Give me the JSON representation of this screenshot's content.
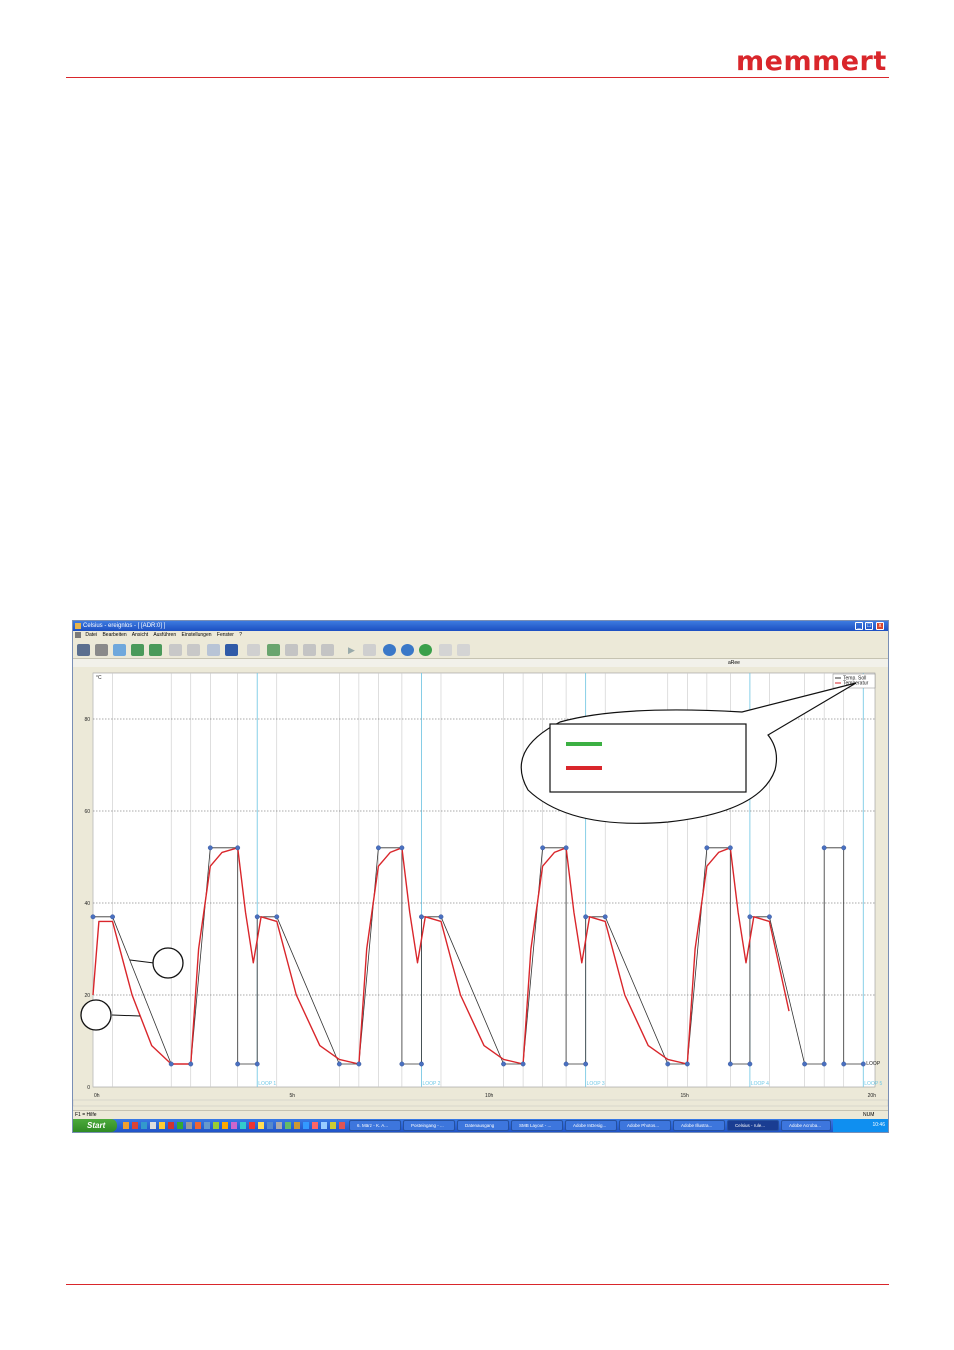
{
  "brand": {
    "logo_text": "memmert",
    "rule_color": "#d9262b"
  },
  "window": {
    "title": "Celsius - ereignlos - [ [ADR:0] ]",
    "menu": [
      "Datei",
      "Bearbeiten",
      "Ansicht",
      "Ausführen",
      "Einstellungen",
      "Fenster",
      "?"
    ],
    "plot_header": "aRee"
  },
  "toolbar": {
    "icons": [
      "open-icon",
      "print-icon",
      "new-page-icon",
      "chart-up-icon",
      "chart-down-icon",
      "undo-icon",
      "redo-icon",
      "grid-dim-icon",
      "grid-icon",
      "pen-icon",
      "chart-edit-icon",
      "redo2-icon",
      "list-icon",
      "table-icon",
      "play-icon",
      "stop-icon",
      "zoom-in-icon",
      "zoom-out-icon",
      "zoom-fit-icon",
      "expand-h-icon",
      "expand-v-icon"
    ]
  },
  "legend": {
    "entries": [
      {
        "name": "Temp. Soll",
        "color": "#333333"
      },
      {
        "name": "Temperatur",
        "color": "#d9262b"
      }
    ],
    "callout_colors": [
      "#3cb043",
      "#d9262b"
    ]
  },
  "callouts": [
    "",
    ""
  ],
  "chart_data": {
    "type": "line",
    "ylabel": "°C",
    "ylim": [
      0,
      90
    ],
    "y_ticks": [
      "0",
      "20",
      "40",
      "60",
      "80"
    ],
    "x_ticks": [
      "0h",
      "5h",
      "10h",
      "15h",
      "20h"
    ],
    "xlim": [
      0,
      20
    ],
    "loop_labels": [
      "LOOP 1",
      "LOOP 2",
      "LOOP 3",
      "LOOP 4",
      "LOOP 5"
    ],
    "end_label": "LOOP",
    "series": [
      {
        "name": "Temp. Soll",
        "color": "#333333",
        "x": [
          0,
          0.5,
          2,
          2.5,
          3,
          3.7,
          3.7,
          4.2,
          4.2,
          4.7,
          6.3,
          6.8,
          7.3,
          7.9,
          7.9,
          8.4,
          8.4,
          8.9,
          10.5,
          11,
          11.5,
          12.1,
          12.1,
          12.6,
          12.6,
          13.1,
          14.7,
          15.2,
          15.7,
          16.3,
          16.3,
          16.8,
          16.8,
          17.3,
          18.2,
          18.7,
          18.7,
          19.2,
          19.2,
          19.7
        ],
        "y": [
          37,
          37,
          5,
          5,
          52,
          52,
          5,
          5,
          37,
          37,
          5,
          5,
          52,
          52,
          5,
          5,
          37,
          37,
          5,
          5,
          52,
          52,
          5,
          5,
          37,
          37,
          5,
          5,
          52,
          52,
          5,
          5,
          37,
          37,
          5,
          5,
          52,
          52,
          5,
          5
        ]
      },
      {
        "name": "Temperatur",
        "color": "#d9262b",
        "x": [
          0,
          0.15,
          0.5,
          1,
          1.5,
          2,
          2.5,
          2.7,
          3,
          3.3,
          3.7,
          3.9,
          4.1,
          4.3,
          4.7,
          5.2,
          5.8,
          6.3,
          6.8,
          7,
          7.3,
          7.6,
          7.9,
          8.1,
          8.3,
          8.5,
          8.9,
          9.4,
          10,
          10.5,
          11,
          11.2,
          11.5,
          11.8,
          12.1,
          12.3,
          12.5,
          12.7,
          13.1,
          13.6,
          14.2,
          14.7,
          15.2,
          15.4,
          15.7,
          16,
          16.3,
          16.5,
          16.7,
          16.9,
          17.3,
          17.8
        ],
        "y": [
          20,
          36,
          36,
          20,
          9,
          5,
          5,
          30,
          48,
          51,
          52,
          38,
          27,
          37,
          36,
          20,
          9,
          6,
          5,
          30,
          48,
          51,
          52,
          38,
          27,
          37,
          36,
          20,
          9,
          6,
          5,
          30,
          48,
          51,
          52,
          38,
          27,
          37,
          36,
          20,
          9,
          6,
          5,
          30,
          48,
          51,
          52,
          38,
          27,
          37,
          36,
          16.5
        ]
      }
    ]
  },
  "status": {
    "left": "F1 = Hilfe",
    "right": "NUM"
  },
  "taskbar": {
    "start_label": "Start",
    "tasks": [
      "6. März - K. A...",
      "Posteingang - ...",
      "Datenausgang",
      "SMB Layout - ...",
      "Adobe InDesig...",
      "Adobe Photos...",
      "Adobe Illustra...",
      "Celsius - rule...",
      "Adobe Acroba..."
    ],
    "clock": "10:46"
  }
}
